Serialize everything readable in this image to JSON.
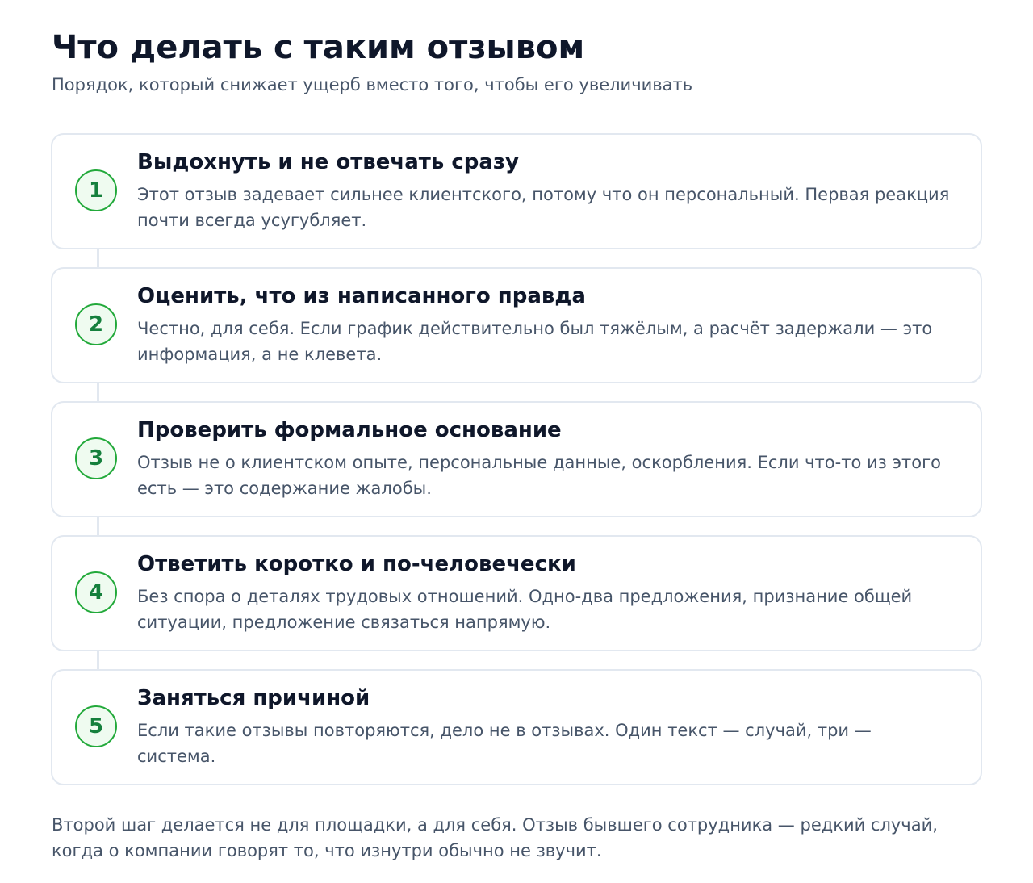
{
  "header": {
    "title": "Что делать с таким отзывом",
    "subtitle": "Порядок, который снижает ущерб вместо того, чтобы его увеличивать"
  },
  "steps": [
    {
      "number": "1",
      "title": "Выдохнуть и не отвечать сразу",
      "text": "Этот отзыв задевает сильнее клиентского, потому что он персональный. Первая реакция почти всегда усугубляет."
    },
    {
      "number": "2",
      "title": "Оценить, что из написанного правда",
      "text": "Честно, для себя. Если график действительно был тяжёлым, а расчёт задержали — это информация, а не клевета."
    },
    {
      "number": "3",
      "title": "Проверить формальное основание",
      "text": "Отзыв не о клиентском опыте, персональные данные, оскорбления. Если что-то из этого есть — это содержание жалобы."
    },
    {
      "number": "4",
      "title": "Ответить коротко и по-человечески",
      "text": "Без спора о деталях трудовых отношений. Одно-два предложения, признание общей ситуации, предложение связаться напрямую."
    },
    {
      "number": "5",
      "title": "Заняться причиной",
      "text": "Если такие отзывы повторяются, дело не в отзывах. Один текст — случай, три — система."
    }
  ],
  "footer": {
    "note": "Второй шаг делается не для площадки, а для себя. Отзыв бывшего сотрудника — редкий случай, когда о компании говорят то, что изнутри обычно не звучит."
  },
  "colors": {
    "accent": "#15803d",
    "accent_border": "#22a93a",
    "accent_bg": "#effbf0",
    "card_border": "#e2e8f0",
    "heading": "#0f172a",
    "body_text": "#475569"
  }
}
